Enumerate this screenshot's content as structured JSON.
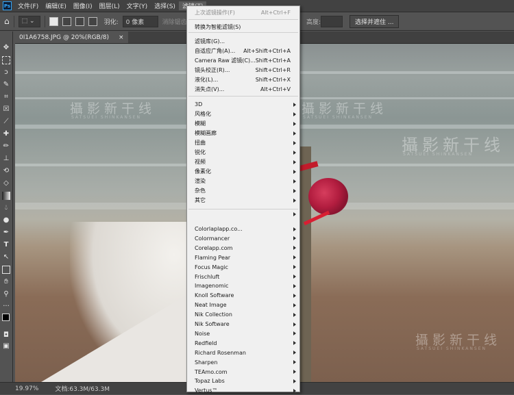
{
  "menubar": {
    "logo": "Ps",
    "items": [
      "文件(F)",
      "编辑(E)",
      "图像(I)",
      "图层(L)",
      "文字(Y)",
      "选择(S)",
      "滤镜(T)"
    ]
  },
  "options": {
    "feather_label": "羽化:",
    "feather_value": "0 像素",
    "antialias_label": "消除锯齿",
    "height_label": "高度:",
    "select_and_mask": "选择并遮住 ..."
  },
  "document_tab": {
    "title": "0I1A6758.JPG @ 20%(RGB/8)",
    "close": "×"
  },
  "status": {
    "zoom": "19.97%",
    "doc_size": "文档:63.3M/63.3M"
  },
  "watermark": {
    "text": "攝影新干线",
    "subtext": "SATSUEI SHINKANSEN"
  },
  "filter_menu": {
    "items": [
      {
        "label": "上次滤镜操作(F)",
        "shortcut": "Alt+Ctrl+F",
        "disabled": true
      },
      {
        "label": "转换为智能滤镜(S)"
      },
      {
        "label": "滤镜库(G)..."
      },
      {
        "label": "自适应广角(A)...",
        "shortcut": "Alt+Shift+Ctrl+A"
      },
      {
        "label": "Camera Raw 滤镜(C)...",
        "shortcut": "Shift+Ctrl+A"
      },
      {
        "label": "镜头校正(R)...",
        "shortcut": "Shift+Ctrl+R"
      },
      {
        "label": "液化(L)...",
        "shortcut": "Shift+Ctrl+X"
      },
      {
        "label": "消失点(V)...",
        "shortcut": "Alt+Ctrl+V"
      },
      {
        "label": "3D",
        "submenu": true
      },
      {
        "label": "风格化",
        "submenu": true
      },
      {
        "label": "模糊",
        "submenu": true
      },
      {
        "label": "模糊画廊",
        "submenu": true
      },
      {
        "label": "扭曲",
        "submenu": true
      },
      {
        "label": "锐化",
        "submenu": true
      },
      {
        "label": "视频",
        "submenu": true
      },
      {
        "label": "像素化",
        "submenu": true
      },
      {
        "label": "渲染",
        "submenu": true
      },
      {
        "label": "杂色",
        "submenu": true
      },
      {
        "label": "其它",
        "submenu": true
      },
      {
        "label": "",
        "submenu": true
      },
      {
        "label": "Colorlaplapp.co...",
        "submenu": true
      },
      {
        "label": "Colormancer",
        "submenu": true
      },
      {
        "label": "Corelapp.com",
        "submenu": true
      },
      {
        "label": "Flaming Pear",
        "submenu": true
      },
      {
        "label": "Focus Magic",
        "submenu": true
      },
      {
        "label": "Frischluft",
        "submenu": true
      },
      {
        "label": "Imagenomic",
        "submenu": true
      },
      {
        "label": "Knoll Software",
        "submenu": true
      },
      {
        "label": "Neat Image",
        "submenu": true
      },
      {
        "label": "Nik Collection",
        "submenu": true
      },
      {
        "label": "Nik Software",
        "submenu": true
      },
      {
        "label": "Noise",
        "submenu": true
      },
      {
        "label": "Redfield",
        "submenu": true
      },
      {
        "label": "Richard Rosenman",
        "submenu": true
      },
      {
        "label": "Sharpen",
        "submenu": true
      },
      {
        "label": "TEAmo.com",
        "submenu": true
      },
      {
        "label": "Topaz Labs",
        "submenu": true
      },
      {
        "label": "Vertus™",
        "submenu": true
      }
    ]
  }
}
